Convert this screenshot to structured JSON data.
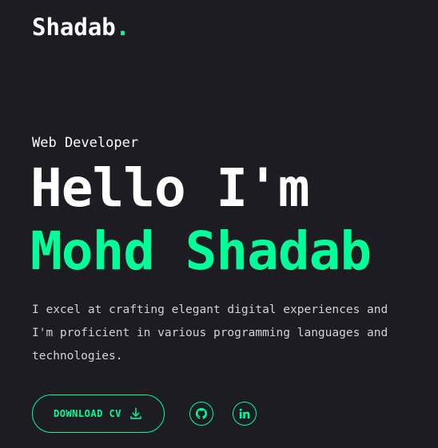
{
  "header": {
    "logo_text": "Shadab",
    "logo_dot": "."
  },
  "hero": {
    "role": "Web Developer",
    "greeting": "Hello I'm",
    "name": "Mohd Shadab",
    "bio": "I excel at crafting elegant digital experiences and I'm proficient in various programming languages and technologies.",
    "cv_button_label": "DOWNLOAD CV"
  },
  "social": [
    {
      "icon": "github-icon"
    },
    {
      "icon": "linkedin-icon"
    }
  ],
  "colors": {
    "background": "#1c1c22",
    "accent": "#00ff99",
    "text": "#ffffff"
  }
}
